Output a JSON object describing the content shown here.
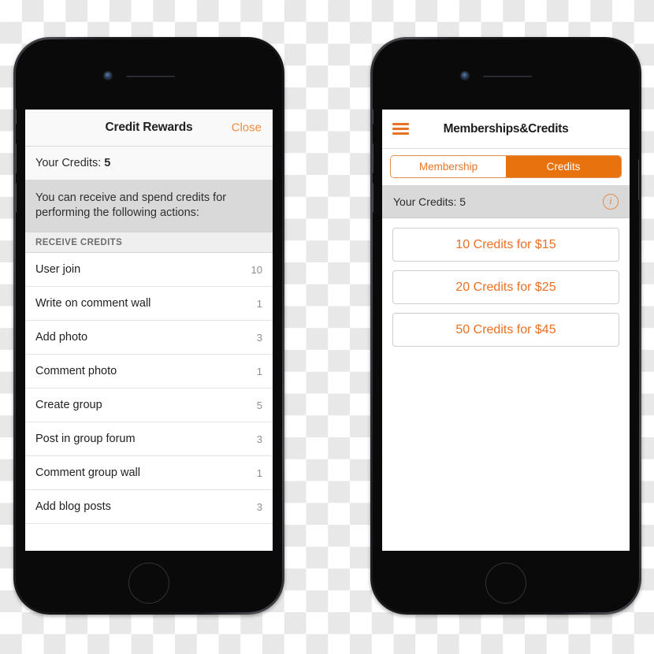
{
  "left_phone": {
    "navbar": {
      "title": "Credit Rewards",
      "close_label": "Close"
    },
    "credits_row": {
      "label": "Your Credits:",
      "value": "5"
    },
    "intro_text": "You can receive and spend credits for performing the following actions:",
    "section_header": "RECEIVE CREDITS",
    "rows": [
      {
        "label": "User join",
        "value": "10"
      },
      {
        "label": "Write on comment wall",
        "value": "1"
      },
      {
        "label": "Add photo",
        "value": "3"
      },
      {
        "label": "Comment photo",
        "value": "1"
      },
      {
        "label": "Create group",
        "value": "5"
      },
      {
        "label": "Post in group forum",
        "value": "3"
      },
      {
        "label": "Comment group wall",
        "value": "1"
      },
      {
        "label": "Add blog posts",
        "value": "3"
      }
    ]
  },
  "right_phone": {
    "navbar": {
      "title": "Memberships&Credits",
      "menu_icon": "hamburger-icon"
    },
    "segmented_control": {
      "options": [
        {
          "label": "Membership",
          "active": false
        },
        {
          "label": "Credits",
          "active": true
        }
      ]
    },
    "credits_row": {
      "text": "Your Credits: 5",
      "info_icon": "info-icon",
      "info_glyph": "i"
    },
    "purchase_options": [
      {
        "label": "10 Credits for $15"
      },
      {
        "label": "20 Credits for $25"
      },
      {
        "label": "50 Credits for $45"
      }
    ]
  },
  "colors": {
    "accent_orange": "#ea7024",
    "segment_active": "#e8720e",
    "close_orange": "#ef8b40",
    "list_gray": "#d9d9d9"
  }
}
